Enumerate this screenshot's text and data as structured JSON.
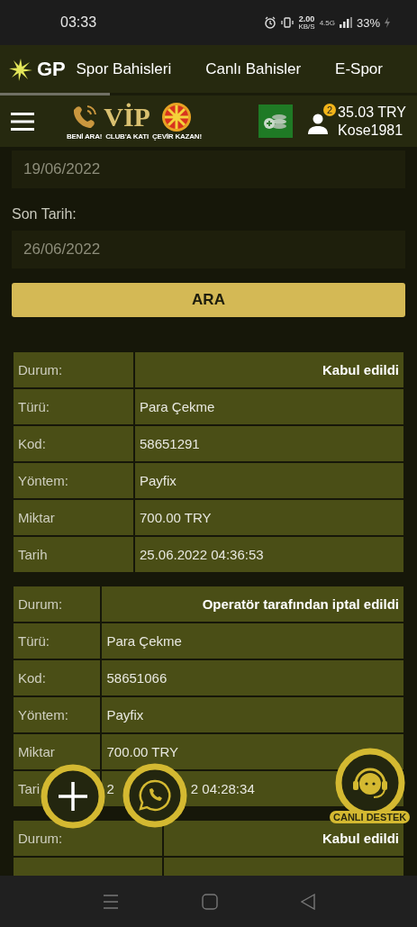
{
  "status_bar": {
    "time": "03:33",
    "speed": "2.00",
    "speed_unit": "KB/S",
    "network": "4.5G",
    "battery": "33%"
  },
  "top_nav": {
    "logo": "GP",
    "items": [
      {
        "label": "Spor Bahisleri"
      },
      {
        "label": "Canlı Bahisler"
      },
      {
        "label": "E-Spor"
      }
    ]
  },
  "header": {
    "promos": [
      {
        "kind": "call",
        "label": "BENİ ARA!"
      },
      {
        "kind": "vip",
        "title": "VİP",
        "label": "CLUB'A KATI"
      },
      {
        "kind": "wheel",
        "label": "ÇEVİR KAZAN!"
      }
    ],
    "notification_count": "2",
    "balance": "35.03 TRY",
    "username": "Kose1981"
  },
  "filter": {
    "start_date": "19/06/2022",
    "end_label": "Son Tarih:",
    "end_date": "26/06/2022",
    "button": "ARA"
  },
  "transactions": [
    {
      "rows": [
        {
          "kind": "status",
          "label": "Durum:",
          "value": "Kabul edildi"
        },
        {
          "kind": "plain",
          "label": "Türü:",
          "value": "Para Çekme"
        },
        {
          "kind": "plain",
          "label": "Kod:",
          "value": "58651291"
        },
        {
          "kind": "plain",
          "label": "Yöntem:",
          "value": "Payfix"
        },
        {
          "kind": "plain",
          "label": "Miktar",
          "value": "700.00 TRY"
        },
        {
          "kind": "plain",
          "label": "Tarih",
          "value": "25.06.2022 04:36:53"
        }
      ]
    },
    {
      "rows": [
        {
          "kind": "status",
          "label": "Durum:",
          "value": "Operatör tarafından iptal edildi"
        },
        {
          "kind": "plain",
          "label": "Türü:",
          "value": "Para Çekme"
        },
        {
          "kind": "plain",
          "label": "Kod:",
          "value": "58651066"
        },
        {
          "kind": "plain",
          "label": "Yöntem:",
          "value": "Payfix"
        },
        {
          "kind": "plain",
          "label": "Miktar",
          "value": "700.00 TRY"
        },
        {
          "kind": "split",
          "label": "Tari",
          "value_parts": [
            "2",
            "2 04:28:34"
          ]
        }
      ]
    },
    {
      "rows": [
        {
          "kind": "status",
          "label": "Durum:",
          "value": "Kabul edildi"
        },
        {
          "kind": "cut"
        }
      ]
    }
  ],
  "support": {
    "label": "CANLI DESTEK"
  }
}
